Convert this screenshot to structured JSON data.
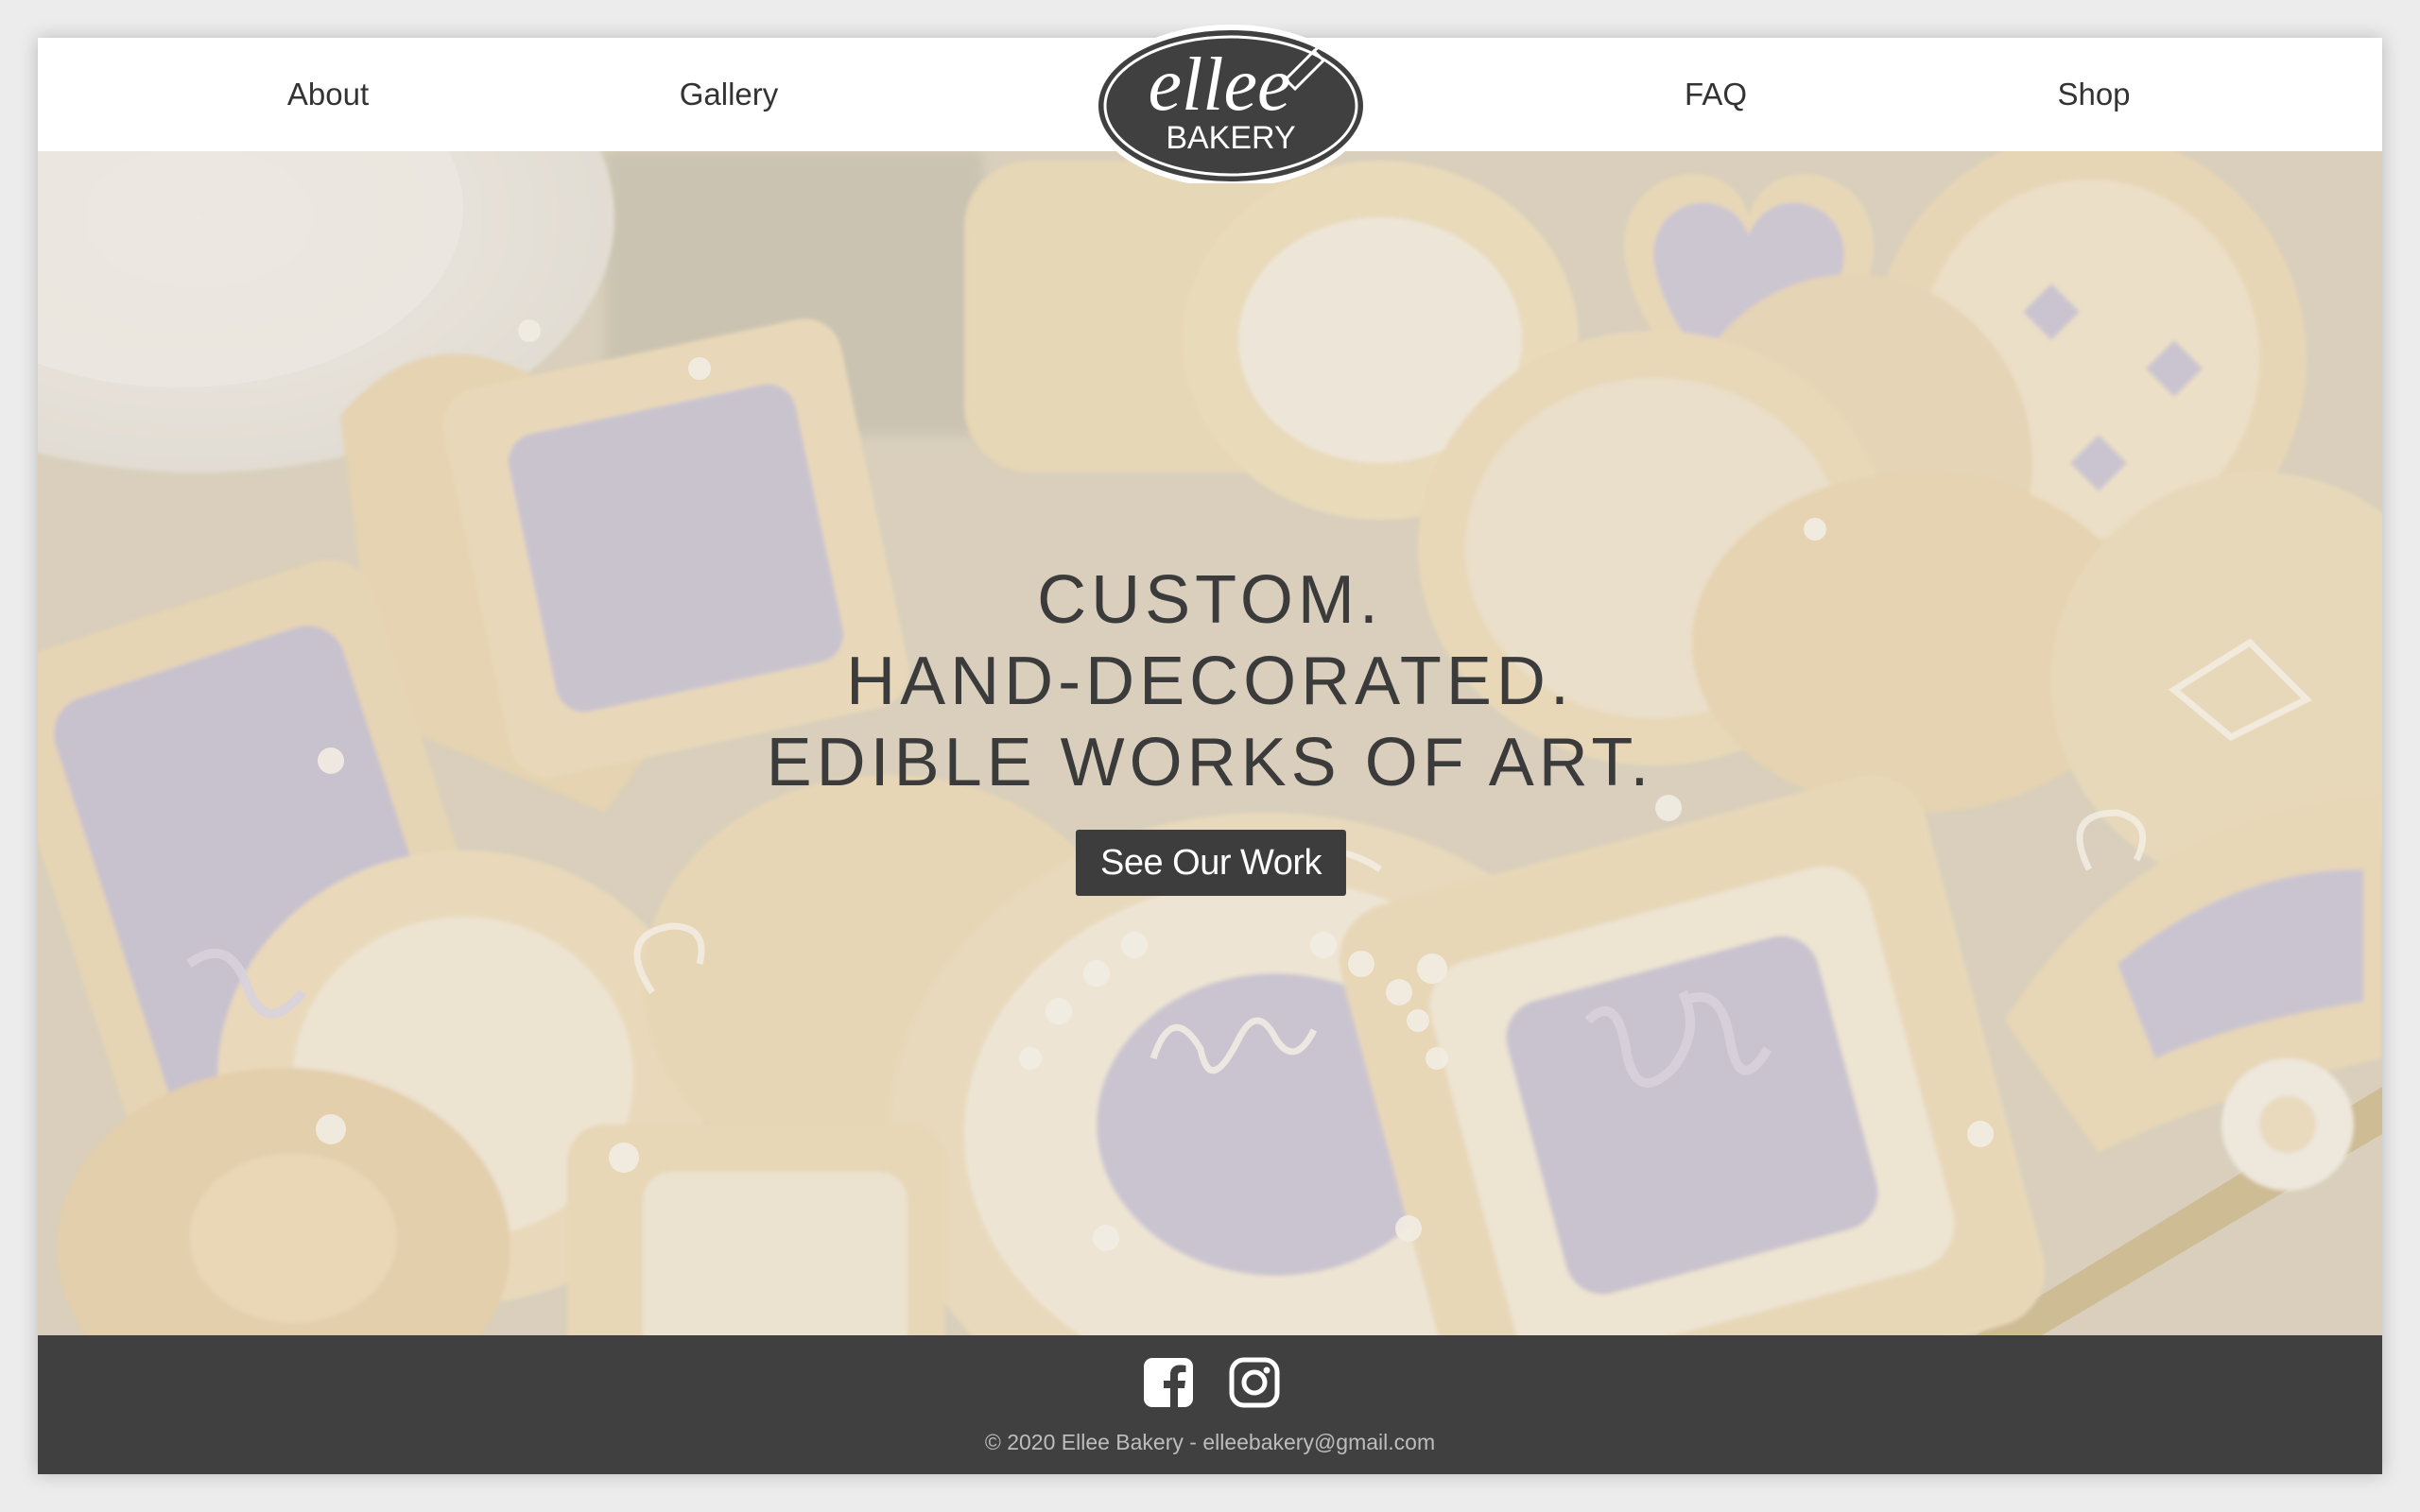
{
  "nav": {
    "links": [
      {
        "label": "About"
      },
      {
        "label": "Gallery"
      },
      {
        "label": "FAQ"
      },
      {
        "label": "Shop"
      }
    ],
    "logo": {
      "script_text": "ellee",
      "sub_text": "BAKERY"
    }
  },
  "hero": {
    "headline_lines": [
      "CUSTOM.",
      "HAND-DECORATED.",
      "EDIBLE WORKS OF ART."
    ],
    "cta_label": "See Our Work",
    "background": "decorated-sugar-cookies-photo"
  },
  "footer": {
    "social_icons": [
      "facebook-icon",
      "instagram-icon"
    ],
    "copyright": "© 2020 Ellee Bakery - elleebakery@gmail.com"
  },
  "colors": {
    "dark": "#404040",
    "text": "#333333",
    "white": "#ffffff",
    "lavender": "#b9b3c9",
    "cookie": "#e3cc9c"
  }
}
